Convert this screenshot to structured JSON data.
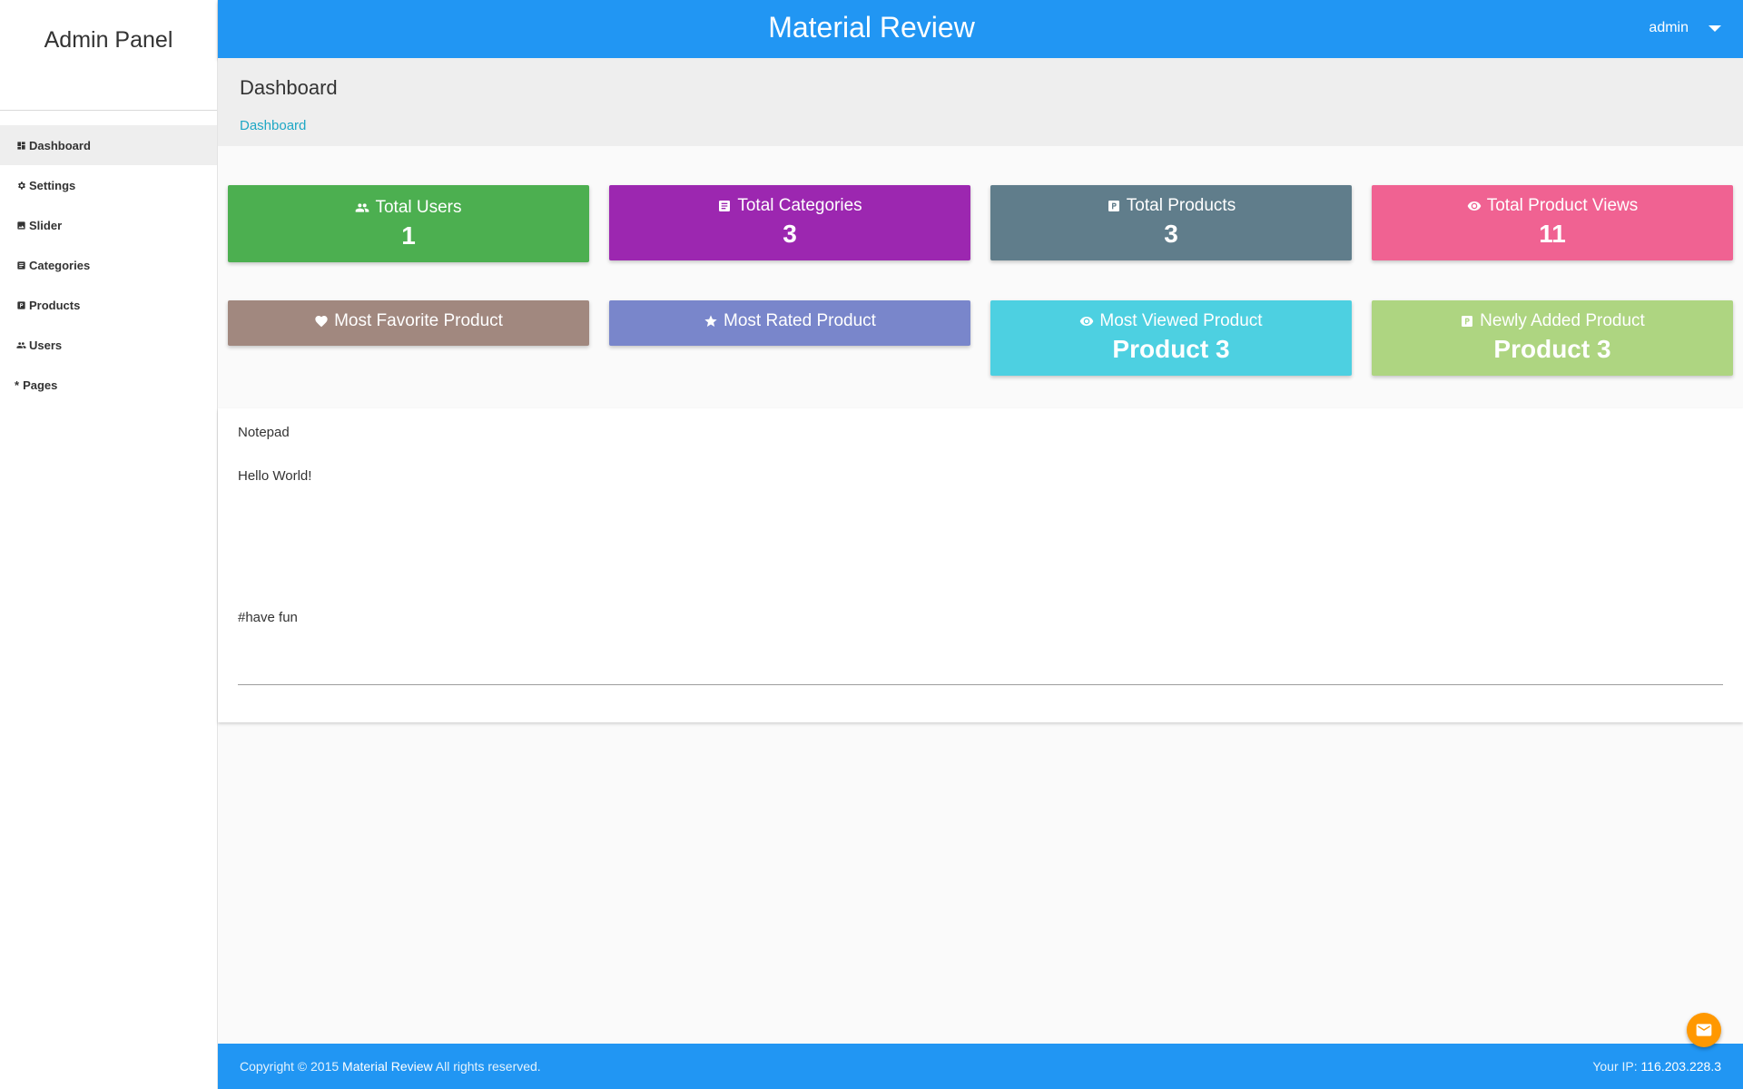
{
  "sidebar": {
    "brand": "Admin Panel",
    "items": [
      {
        "label": "Dashboard",
        "icon": "dashboard-icon",
        "active": true
      },
      {
        "label": "Settings",
        "icon": "gear-icon"
      },
      {
        "label": "Slider",
        "icon": "image-icon"
      },
      {
        "label": "Categories",
        "icon": "category-icon"
      },
      {
        "label": "Products",
        "icon": "product-icon"
      },
      {
        "label": "Users",
        "icon": "users-icon"
      },
      {
        "label": "Pages",
        "icon": "asterisk-icon"
      }
    ]
  },
  "header": {
    "title": "Material Review",
    "user": "admin"
  },
  "page": {
    "title": "Dashboard",
    "breadcrumb": "Dashboard"
  },
  "stats": [
    {
      "label": "Total Users",
      "value": "1",
      "icon": "users-icon",
      "color": "#4caf50"
    },
    {
      "label": "Total Categories",
      "value": "3",
      "icon": "category-icon",
      "color": "#9c27b0"
    },
    {
      "label": "Total Products",
      "value": "3",
      "icon": "product-icon",
      "color": "#607d8b"
    },
    {
      "label": "Total Product Views",
      "value": "11",
      "icon": "eye-icon",
      "color": "#f06292"
    }
  ],
  "highlights": [
    {
      "label": "Most Favorite Product",
      "value": "",
      "icon": "heart-icon",
      "color": "#a1887f"
    },
    {
      "label": "Most Rated Product",
      "value": "",
      "icon": "star-icon",
      "color": "#7986cb"
    },
    {
      "label": "Most Viewed Product",
      "value": "Product 3",
      "icon": "eye-icon",
      "color": "#4dd0e1"
    },
    {
      "label": "Newly Added Product",
      "value": "Product 3",
      "icon": "product-icon",
      "color": "#aed581"
    }
  ],
  "notepad": {
    "label": "Notepad",
    "text": "Hello World!\n\n\n\n\n\n\n\n#have fun"
  },
  "footer": {
    "copyright_prefix": "Copyright © 2015",
    "brand_link": "Material Review",
    "copyright_suffix": "All rights reserved.",
    "ip_label": "Your IP:",
    "ip_value": "116.203.228.3"
  },
  "fab_icon": "mail-icon"
}
